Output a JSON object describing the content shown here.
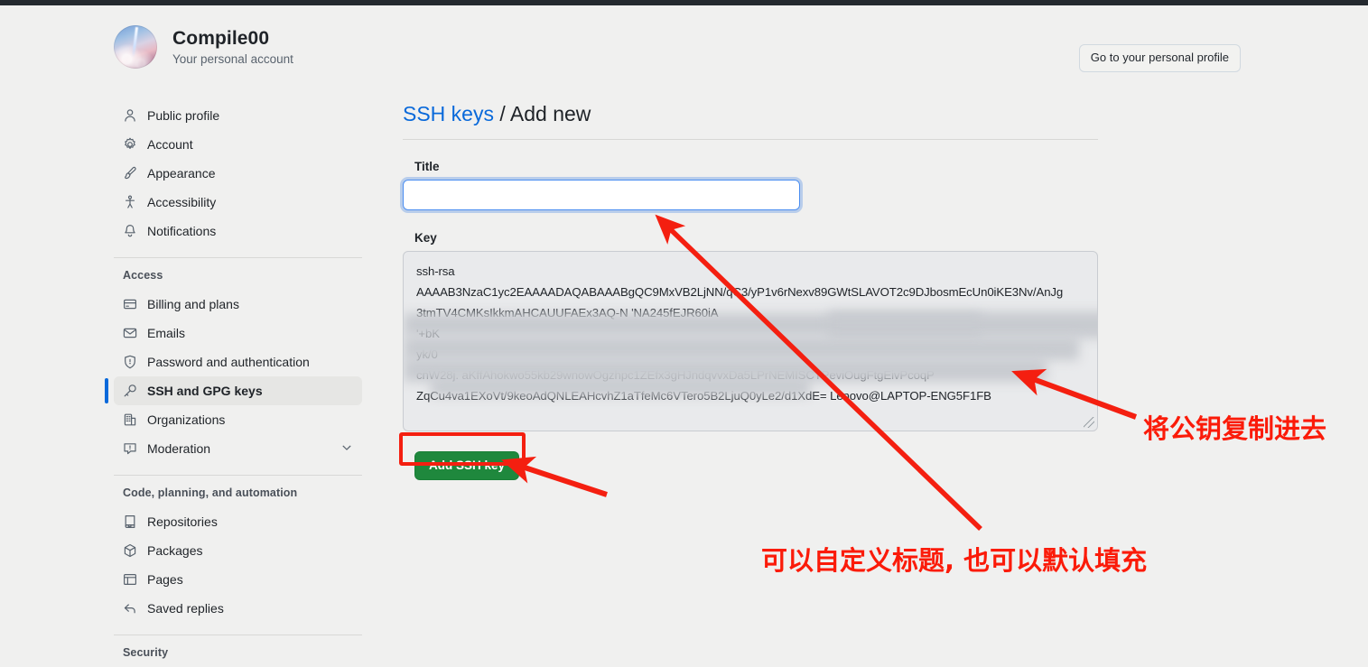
{
  "account": {
    "name": "Compile00",
    "subtitle": "Your personal account",
    "avatar_icon": "user-avatar-image",
    "profile_button": "Go to your personal profile"
  },
  "sidebar": {
    "groups": [
      {
        "heading": "",
        "items": [
          {
            "label": "Public profile",
            "icon": "person-icon",
            "active": false
          },
          {
            "label": "Account",
            "icon": "gear-icon",
            "active": false
          },
          {
            "label": "Appearance",
            "icon": "paintbrush-icon",
            "active": false
          },
          {
            "label": "Accessibility",
            "icon": "accessibility-icon",
            "active": false
          },
          {
            "label": "Notifications",
            "icon": "bell-icon",
            "active": false
          }
        ]
      },
      {
        "heading": "Access",
        "items": [
          {
            "label": "Billing and plans",
            "icon": "credit-card-icon",
            "active": false
          },
          {
            "label": "Emails",
            "icon": "mail-icon",
            "active": false
          },
          {
            "label": "Password and authentication",
            "icon": "shield-lock-icon",
            "active": false
          },
          {
            "label": "SSH and GPG keys",
            "icon": "key-icon",
            "active": true
          },
          {
            "label": "Organizations",
            "icon": "organization-icon",
            "active": false
          },
          {
            "label": "Moderation",
            "icon": "report-icon",
            "active": false,
            "chevron": "chevron-down-icon"
          }
        ]
      },
      {
        "heading": "Code, planning, and automation",
        "items": [
          {
            "label": "Repositories",
            "icon": "repo-icon",
            "active": false
          },
          {
            "label": "Packages",
            "icon": "package-icon",
            "active": false
          },
          {
            "label": "Pages",
            "icon": "browser-icon",
            "active": false
          },
          {
            "label": "Saved replies",
            "icon": "reply-icon",
            "active": false
          }
        ]
      },
      {
        "heading": "Security",
        "items": []
      }
    ]
  },
  "main": {
    "breadcrumb_link": "SSH keys",
    "breadcrumb_separator": "/",
    "breadcrumb_current": "Add new",
    "title_label": "Title",
    "title_value": "",
    "title_placeholder": "",
    "key_label": "Key",
    "key_lines": [
      "ssh-rsa",
      "AAAAB3NzaC1yc2EAAAADAQABAAABgQC9MxVB2LjNN/qC3/yP1v6rNexv89GWtSLAVOT2c9DJbosmEcUn0iKE3Nv/AnJg",
      "3tmTV4CMKsIkkmAHCAUUFAEx3AQ-N                                                  'NA245fEJR60iA",
      "                                                                                        '+bK",
      "                                                                                        yk/0",
      "cnW28j.              aKffAhokwo55kb29wnowOgzhpc1ZEfx3gHJndqvvxDa5LPrNEMISCTPeviOugFtgEivPcoqP",
      "ZqCu4va1EXoVt/9keoAdQNLEAHcvhZ1aTfeMc6VTero5B2LjuQ0yLe2/d1XdE= Lenovo@LAPTOP-ENG5F1FB"
    ],
    "submit_button": "Add SSH key"
  },
  "annotations": {
    "copy_key_text": "将公钥复制进去",
    "title_text": "可以自定义标题, 也可以默认填充",
    "color": "#fb1b09"
  }
}
